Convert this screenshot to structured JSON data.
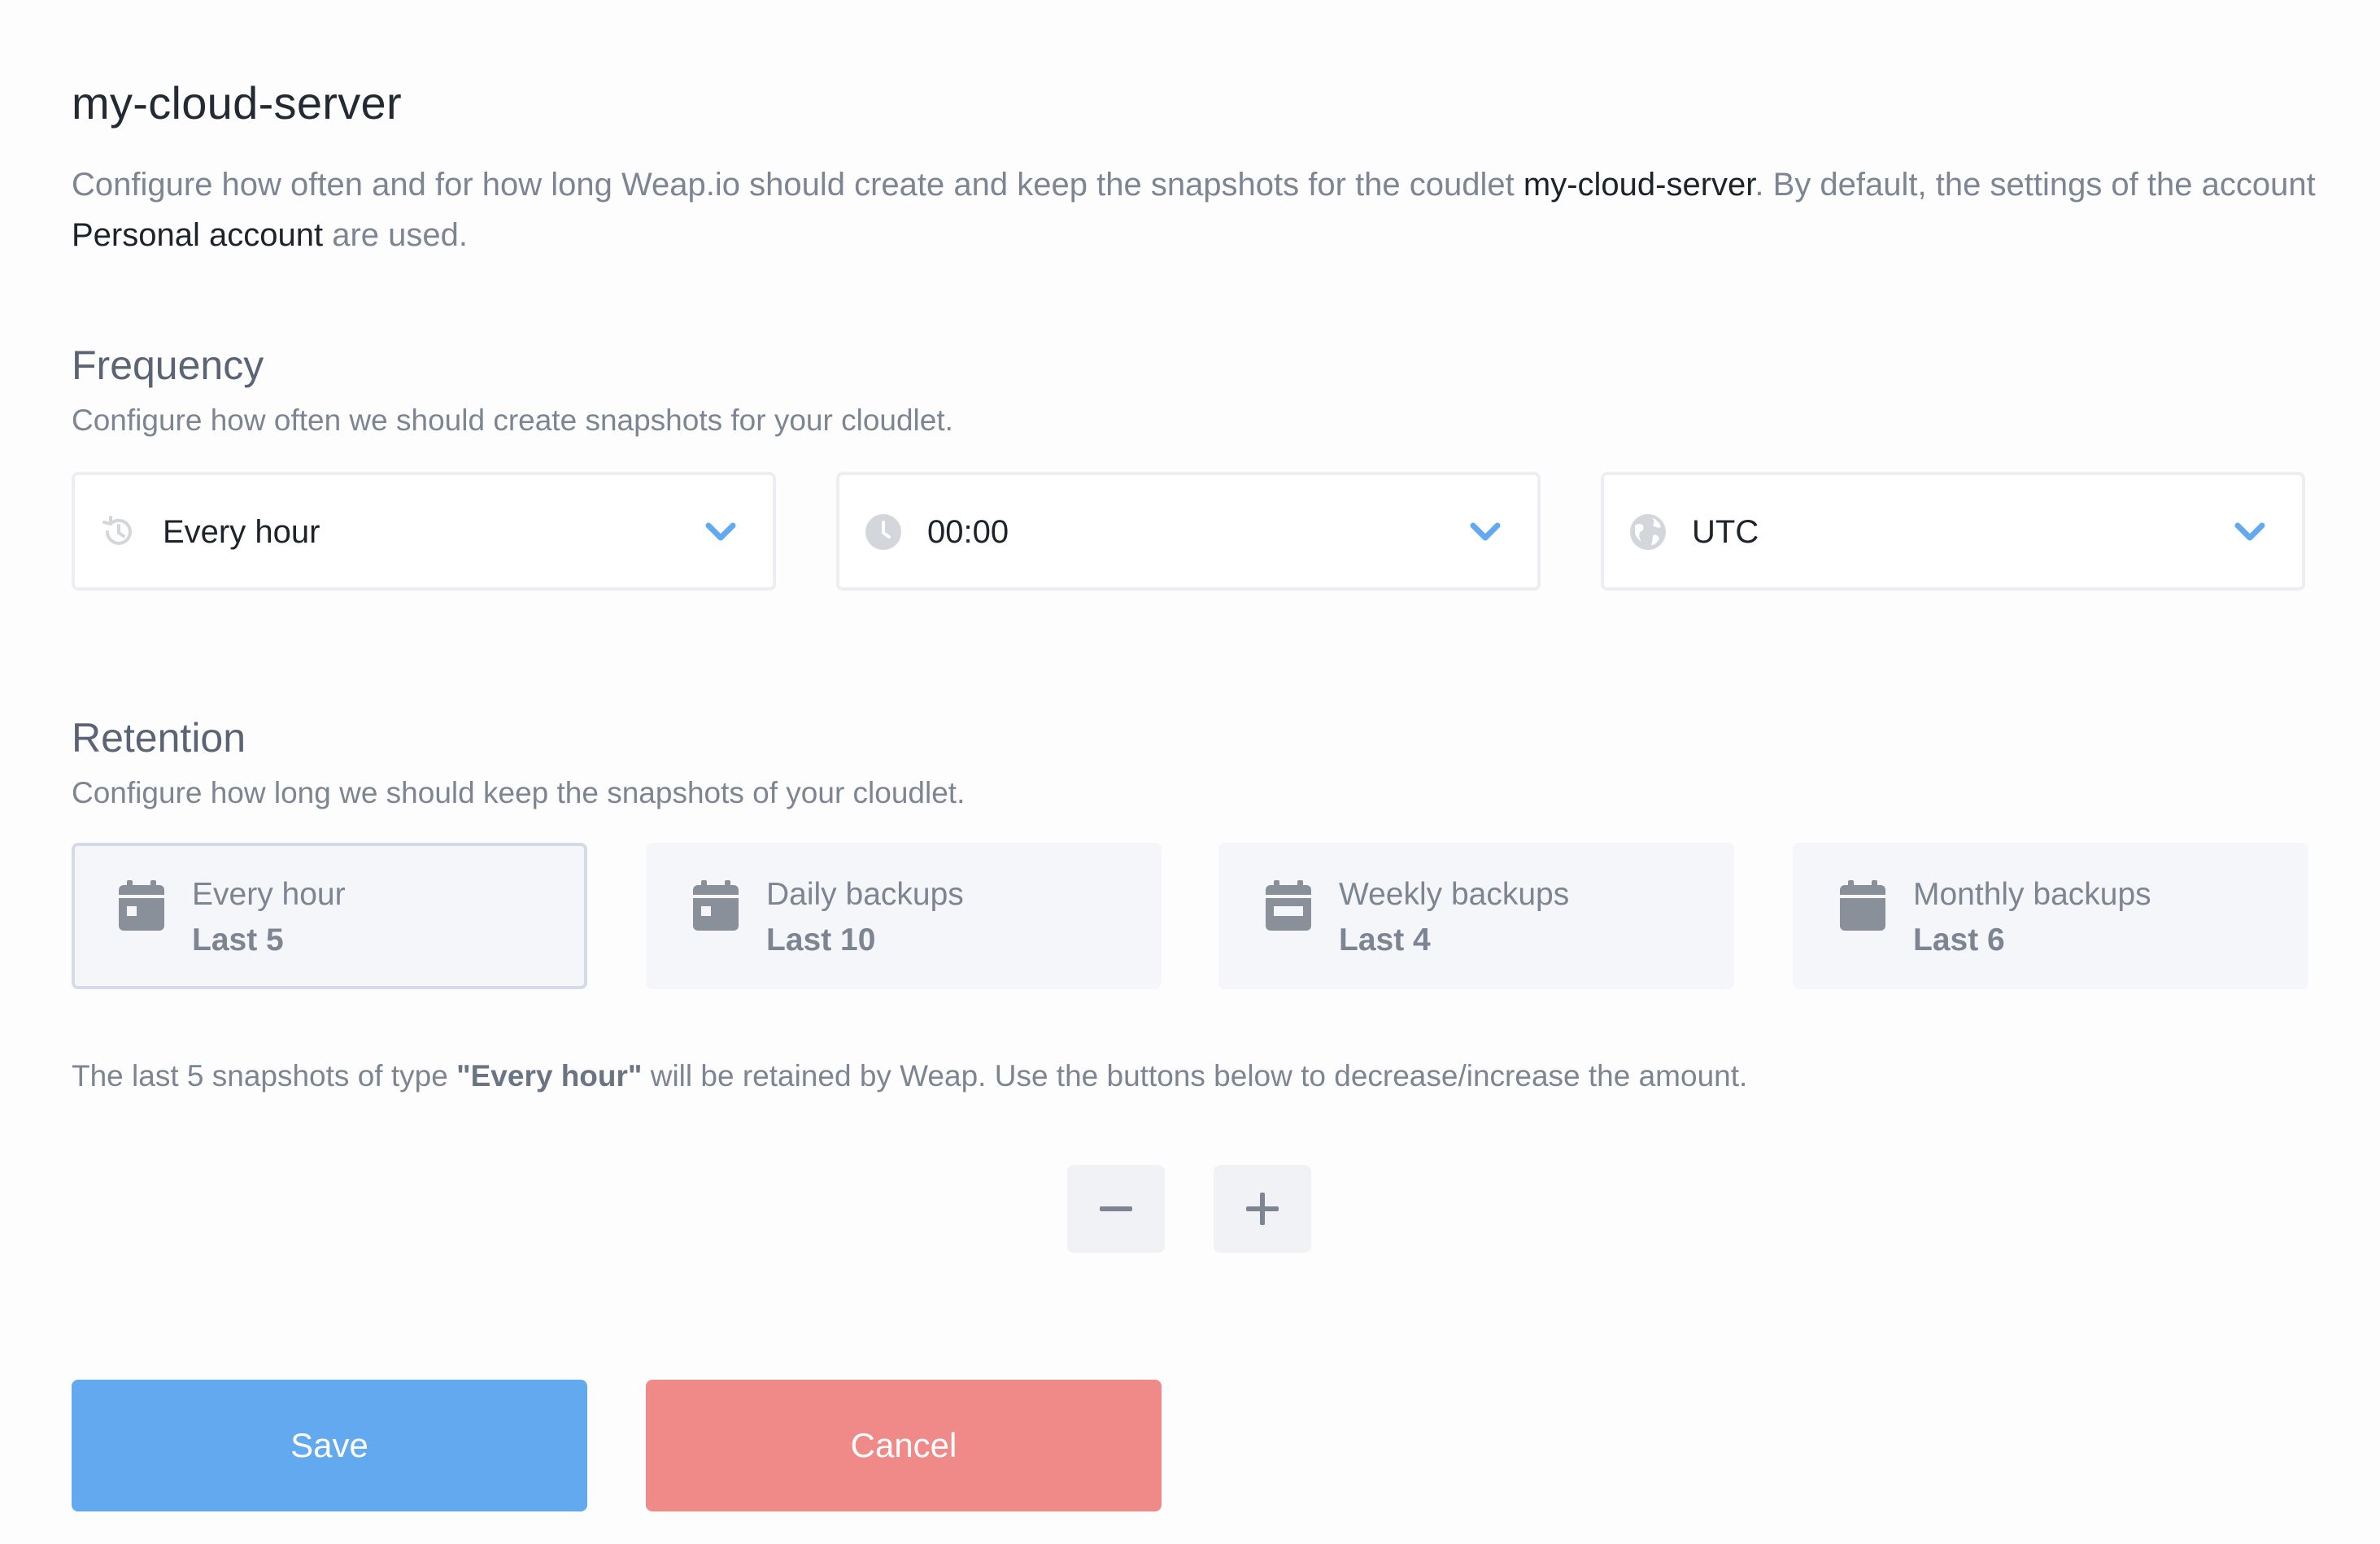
{
  "title": "my-cloud-server",
  "intro": {
    "part1": "Configure how often and for how long Weap.io should create and keep the snapshots for the coudlet ",
    "server": "my-cloud-server",
    "part2": ". By default, the settings of the account ",
    "account": "Personal account",
    "part3": " are used."
  },
  "frequency": {
    "heading": "Frequency",
    "description": "Configure how often we should create snapshots for your cloudlet.",
    "interval": {
      "value": "Every hour",
      "icon": "history-icon"
    },
    "time": {
      "value": "00:00",
      "icon": "clock-icon"
    },
    "timezone": {
      "value": "UTC",
      "icon": "globe-icon"
    }
  },
  "retention": {
    "heading": "Retention",
    "description": "Configure how long we should keep the snapshots of your cloudlet.",
    "cards": [
      {
        "label": "Every hour",
        "value": "Last 5",
        "active": true
      },
      {
        "label": "Daily backups",
        "value": "Last 10",
        "active": false
      },
      {
        "label": "Weekly backups",
        "value": "Last 4",
        "active": false
      },
      {
        "label": "Monthly backups",
        "value": "Last 6",
        "active": false
      }
    ],
    "note": {
      "prefix": "The last 5 snapshots of type ",
      "type": "\"Every hour\"",
      "suffix": " will be retained by Weap. Use the buttons below to decrease/increase the amount."
    }
  },
  "actions": {
    "save": "Save",
    "cancel": "Cancel"
  },
  "colors": {
    "accent": "#63a9ef",
    "danger": "#ef8a88",
    "chevron": "#63a9ef",
    "icon": "#8a9099"
  }
}
